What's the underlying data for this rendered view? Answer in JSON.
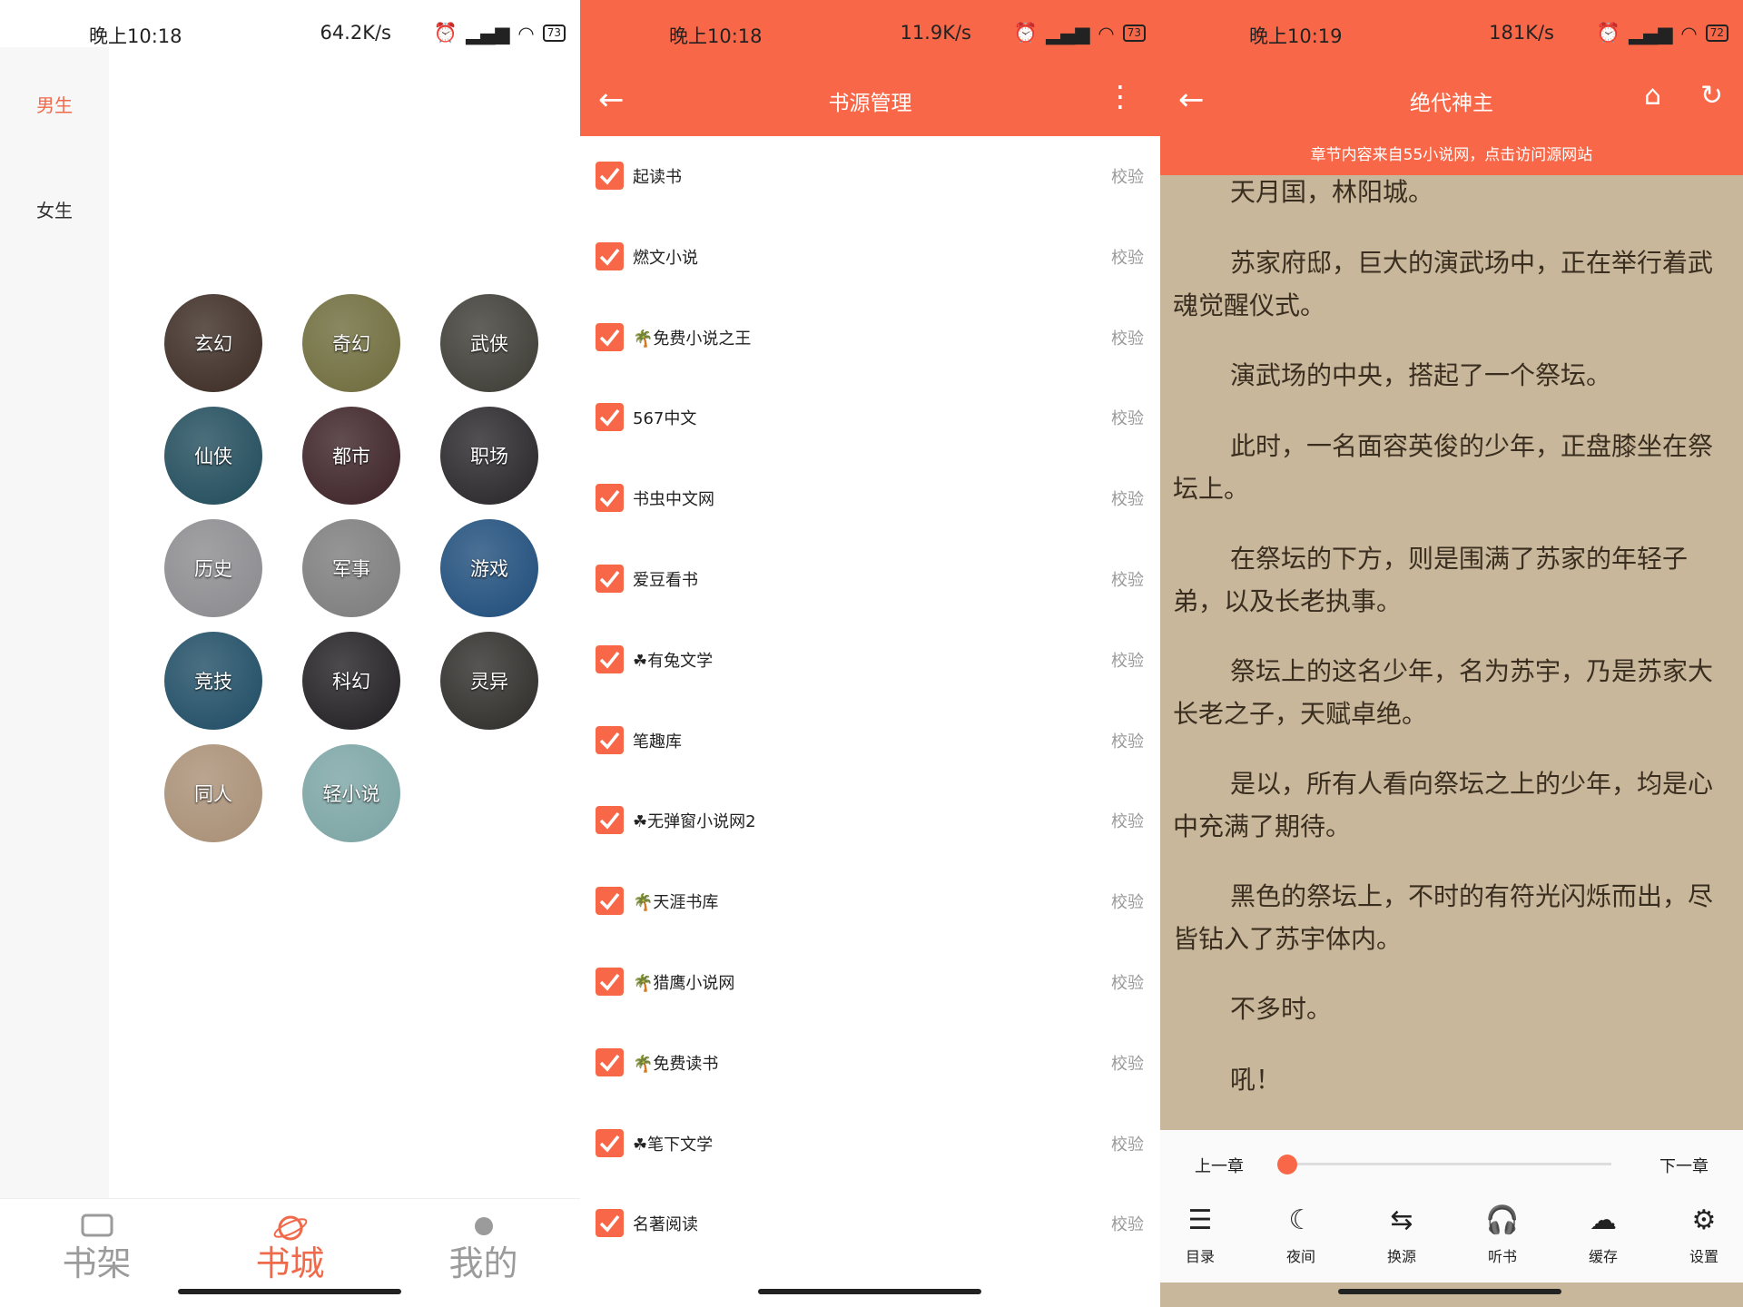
{
  "panel1": {
    "status": {
      "time": "晚上10:18",
      "net": "64.2K/s",
      "battery": "73"
    },
    "categories": [
      "男生",
      "女生"
    ],
    "genres": [
      {
        "label": "玄幻",
        "color": "#3a2a22"
      },
      {
        "label": "奇幻",
        "color": "#6d6a3a"
      },
      {
        "label": "武侠",
        "color": "#3b3a33"
      },
      {
        "label": "仙侠",
        "color": "#1f4a5a"
      },
      {
        "label": "都市",
        "color": "#3a2024"
      },
      {
        "label": "职场",
        "color": "#262427"
      },
      {
        "label": "历史",
        "color": "#8a8a8e"
      },
      {
        "label": "军事",
        "color": "#7b7b7b"
      },
      {
        "label": "游戏",
        "color": "#1d4c7a"
      },
      {
        "label": "竞技",
        "color": "#1d4b63"
      },
      {
        "label": "科幻",
        "color": "#1f1d20"
      },
      {
        "label": "灵异",
        "color": "#2c2b28"
      },
      {
        "label": "同人",
        "color": "#a88e74"
      },
      {
        "label": "轻小说",
        "color": "#7aa3a3"
      }
    ],
    "tabs": [
      "书架",
      "书城",
      "我的"
    ],
    "accent": "#f0694a"
  },
  "panel2": {
    "status": {
      "time": "晚上10:18",
      "net": "11.9K/s",
      "battery": "73"
    },
    "title": "书源管理",
    "verify_label": "校验",
    "sources": [
      "起读书",
      "燃文小说",
      "🌴免费小说之王",
      "567中文",
      "书虫中文网",
      "爱豆看书",
      "☘有兔文学",
      "笔趣库",
      "☘无弹窗小说网2",
      "🌴天涯书库",
      "🌴猎鹰小说网",
      "🌴免费读书",
      "☘笔下文学",
      "名著阅读"
    ],
    "accent": "#f86848"
  },
  "panel3": {
    "status": {
      "time": "晚上10:19",
      "net": "181K/s",
      "battery": "72"
    },
    "title": "绝代神主",
    "notice": "章节内容来自55小说网，点击访问源网站",
    "paragraphs": [
      "天月国，林阳城。",
      "苏家府邸，巨大的演武场中，正在举行着武魂觉醒仪式。",
      "演武场的中央，搭起了一个祭坛。",
      "此时，一名面容英俊的少年，正盘膝坐在祭坛上。",
      "在祭坛的下方，则是围满了苏家的年轻子弟，以及长老执事。",
      "祭坛上的这名少年，名为苏宇，乃是苏家大长老之子，天赋卓绝。",
      "是以，所有人看向祭坛之上的少年，均是心中充满了期待。",
      "黑色的祭坛上，不时的有符光闪烁而出，尽皆钻入了苏宇体内。",
      "不多时。",
      "吼！"
    ],
    "prev_chapter": "上一章",
    "next_chapter": "下一章",
    "progress": 0.0,
    "tools": [
      {
        "label": "目录",
        "icon": "list-icon",
        "glyph": "☰"
      },
      {
        "label": "夜间",
        "icon": "moon-icon",
        "glyph": "☾"
      },
      {
        "label": "换源",
        "icon": "swap-icon",
        "glyph": "⇆"
      },
      {
        "label": "听书",
        "icon": "headphones-icon",
        "glyph": "🎧"
      },
      {
        "label": "缓存",
        "icon": "cloud-download-icon",
        "glyph": "☁"
      },
      {
        "label": "设置",
        "icon": "gear-icon",
        "glyph": "⚙"
      }
    ]
  }
}
